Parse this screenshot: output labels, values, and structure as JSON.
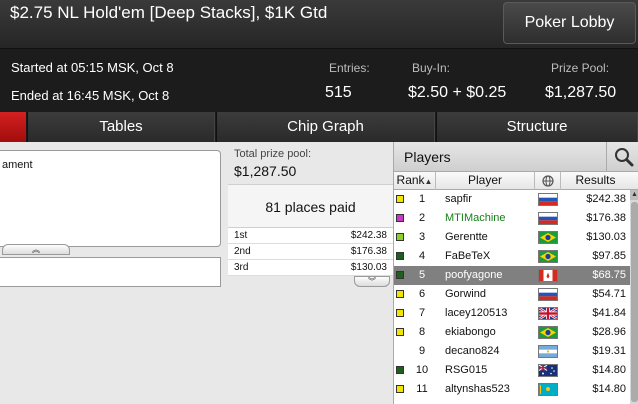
{
  "title": "$2.75 NL Hold'em [Deep Stacks], $1K Gtd",
  "lobby_button": "Poker Lobby",
  "started": "Started at 05:15 MSK, Oct 8",
  "ended": "Ended at 16:45 MSK, Oct 8",
  "stats": {
    "entries_label": "Entries:",
    "entries": "515",
    "buyin_label": "Buy-In:",
    "buyin": "$2.50 + $0.25",
    "prize_label": "Prize Pool:",
    "prize": "$1,287.50"
  },
  "tabs": {
    "tables": "Tables",
    "chip_graph": "Chip Graph",
    "structure": "Structure"
  },
  "left_panel": {
    "text": "ament"
  },
  "mid": {
    "total_label": "Total prize pool:",
    "total_value": "$1,287.50",
    "places": "81 places paid",
    "payouts": [
      {
        "place": "1st",
        "amount": "$242.38"
      },
      {
        "place": "2nd",
        "amount": "$176.38"
      },
      {
        "place": "3rd",
        "amount": "$130.03"
      }
    ]
  },
  "players_panel": {
    "title": "Players",
    "columns": {
      "rank": "Rank",
      "player": "Player",
      "results": "Results"
    },
    "rows": [
      {
        "rank": "1",
        "name": "sapfir",
        "result": "$242.38",
        "marker": "#f2e600",
        "flag": "russia",
        "name_color": "#111111"
      },
      {
        "rank": "2",
        "name": "MTIMachine",
        "result": "$176.38",
        "marker": "#c63ac6",
        "flag": "russia",
        "name_color": "#188018"
      },
      {
        "rank": "3",
        "name": "Gerentte",
        "result": "$130.03",
        "marker": "#8bd02a",
        "flag": "brazil",
        "name_color": "#111111"
      },
      {
        "rank": "4",
        "name": "FaBeTeX",
        "result": "$97.85",
        "marker": "#1d5f1d",
        "flag": "brazil",
        "name_color": "#111111"
      },
      {
        "rank": "5",
        "name": "poofyagone",
        "result": "$68.75",
        "marker": "#1d5f1d",
        "flag": "canada",
        "name_color": "#ffffff",
        "selected": true
      },
      {
        "rank": "6",
        "name": "Gorwind",
        "result": "$54.71",
        "marker": "#f2e600",
        "flag": "russia",
        "name_color": "#111111"
      },
      {
        "rank": "7",
        "name": "lacey120513",
        "result": "$41.84",
        "marker": "#f2e600",
        "flag": "uk",
        "name_color": "#111111"
      },
      {
        "rank": "8",
        "name": "ekiabongo",
        "result": "$28.96",
        "marker": "#f2e600",
        "flag": "brazil",
        "name_color": "#111111"
      },
      {
        "rank": "9",
        "name": "decano824",
        "result": "$19.31",
        "marker": "",
        "flag": "argentina",
        "name_color": "#111111"
      },
      {
        "rank": "10",
        "name": "RSG015",
        "result": "$14.80",
        "marker": "#1d5f1d",
        "flag": "australia",
        "name_color": "#111111"
      },
      {
        "rank": "11",
        "name": "altynshas523",
        "result": "$14.80",
        "marker": "#f2e600",
        "flag": "kazakhstan",
        "name_color": "#111111"
      }
    ]
  }
}
